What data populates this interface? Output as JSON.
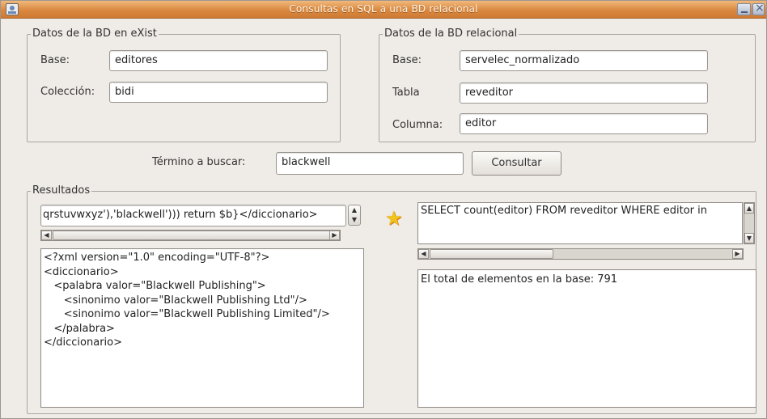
{
  "window": {
    "title": "Consultas en SQL a una BD relacional"
  },
  "exist_group": {
    "legend": "Datos de la BD en eXist",
    "base_label": "Base:",
    "base_value": "editores",
    "coleccion_label": "Colección:",
    "coleccion_value": "bidi"
  },
  "relational_group": {
    "legend": "Datos de la BD relacional",
    "base_label": "Base:",
    "base_value": "servelec_normalizado",
    "tabla_label": "Tabla",
    "tabla_value": "reveditor",
    "columna_label": "Columna:",
    "columna_value": "editor"
  },
  "search": {
    "label": "Término a buscar:",
    "value": "blackwell",
    "button_label": "Consultar"
  },
  "results": {
    "legend": "Resultados",
    "xquery_text": "qrstuvwxyz'),'blackwell')))  return $b}</diccionario>",
    "sql_text": "SELECT count(editor) FROM reveditor WHERE editor in",
    "xml_lines": [
      "<?xml version=\"1.0\" encoding=\"UTF-8\"?>",
      "<diccionario>",
      "   <palabra valor=\"Blackwell Publishing\">",
      "      <sinonimo valor=\"Blackwell Publishing Ltd\"/>",
      "      <sinonimo valor=\"Blackwell Publishing Limited\"/>",
      "   </palabra>",
      "</diccionario>"
    ],
    "total_text": "El total de elementos en la base: 791"
  },
  "icons": {
    "app": "app-window-icon",
    "star": "star-icon",
    "minimize": "minimize-icon",
    "close": "close-icon"
  },
  "colors": {
    "titlebar": "#d9883f",
    "window_bg": "#efebe7",
    "star": "#f2c318"
  }
}
